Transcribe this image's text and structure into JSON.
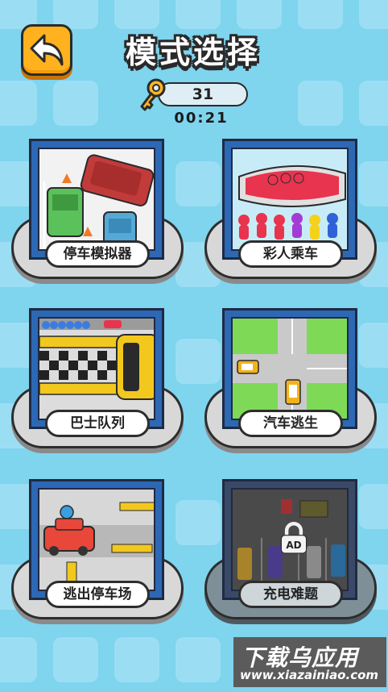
{
  "header": {
    "title": "模式选择",
    "keys": "31",
    "timer": "00:21"
  },
  "modes": [
    {
      "label": "停车模拟器",
      "locked": false
    },
    {
      "label": "彩人乘车",
      "locked": false
    },
    {
      "label": "巴士队列",
      "locked": false
    },
    {
      "label": "汽车逃生",
      "locked": false
    },
    {
      "label": "逃出停车场",
      "locked": false
    },
    {
      "label": "充电难题",
      "locked": true,
      "badge": "AD"
    }
  ],
  "watermark": {
    "line1": "下载乌应用",
    "line2": "www.xiazainiao.com"
  },
  "colors": {
    "background": "#7fd4ee",
    "back_button": "#ffb21e",
    "frame": "#2d68b4"
  }
}
